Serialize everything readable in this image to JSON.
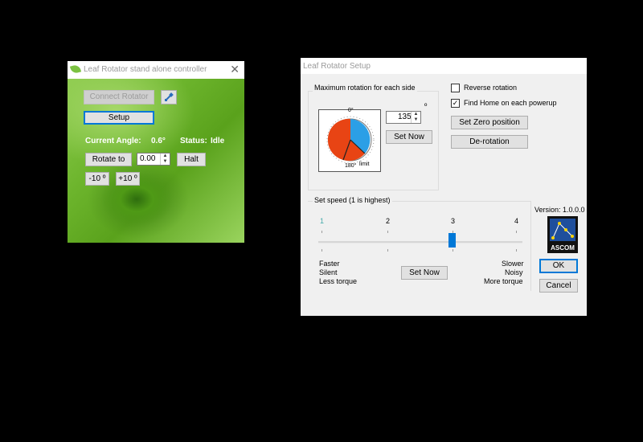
{
  "controller": {
    "title": "Leaf Rotator stand alone controller",
    "connect_label": "Connect Rotator",
    "setup_label": "Setup",
    "current_angle_label": "Current Angle:",
    "current_angle_value": "0.6°",
    "status_label": "Status:",
    "status_value": "Idle",
    "rotate_to_label": "Rotate to",
    "rotate_value": "0.00",
    "halt_label": "Halt",
    "minus10_label": "-10 º",
    "plus10_label": "+10 º"
  },
  "setup": {
    "title": "Leaf Rotator Setup",
    "max_rotation_group": "Maximum rotation for each side",
    "degree_symbol": "º",
    "max_rotation_value": "135",
    "set_now_label": "Set Now",
    "dial_top_label": "0°",
    "dial_bottom_label": "180°",
    "dial_limit_label": "limit",
    "reverse_rotation_label": "Reverse rotation",
    "reverse_rotation_checked": false,
    "find_home_label": "Find Home on each powerup",
    "find_home_checked": true,
    "set_zero_label": "Set Zero position",
    "derotation_label": "De-rotation",
    "speed_group": "Set speed (1 is highest)",
    "speed_ticks": [
      "1",
      "2",
      "3",
      "4"
    ],
    "speed_value": 3,
    "left_desc": [
      "Faster",
      "Silent",
      "Less torque"
    ],
    "right_desc": [
      "Slower",
      "Noisy",
      "More torque"
    ],
    "speed_set_now_label": "Set Now",
    "version": "Version: 1.0.0.0",
    "logo_text": "ASCOM",
    "ok_label": "OK",
    "cancel_label": "Cancel"
  }
}
